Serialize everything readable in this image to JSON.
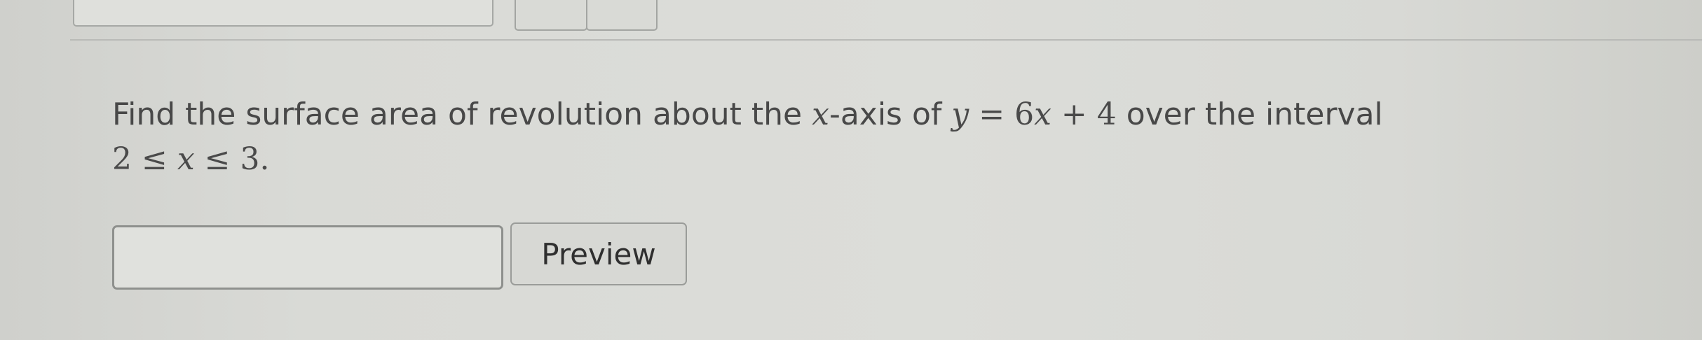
{
  "question": {
    "line1_text": "Find the surface area of revolution about the ",
    "line1_var": "x",
    "line1_mid": "-axis of ",
    "equation_lhs": "y",
    "equation_eq": " = ",
    "equation_coef": "6",
    "equation_var": "x",
    "equation_tail": " + 4",
    "line1_end": " over the interval",
    "interval_lower": "2",
    "interval_le1": " ≤ ",
    "interval_var": "x",
    "interval_le2": " ≤ ",
    "interval_upper": "3."
  },
  "answer": {
    "value": "",
    "preview_label": "Preview"
  }
}
